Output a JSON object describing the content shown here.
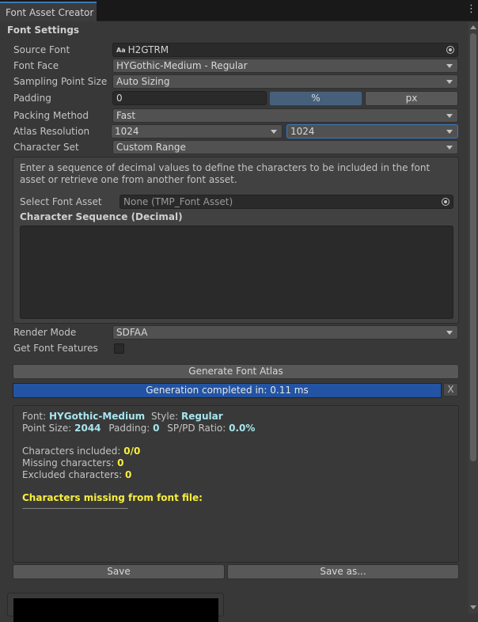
{
  "window": {
    "tab_title": "Font Asset Creator",
    "menu_icon": "kebab-menu-icon"
  },
  "font_settings": {
    "section_title": "Font Settings",
    "source_font": {
      "label": "Source Font",
      "value": "H2GTRM",
      "icon": "font-asset-icon"
    },
    "font_face": {
      "label": "Font Face",
      "value": "HYGothic-Medium - Regular"
    },
    "sampling_point_size": {
      "label": "Sampling Point Size",
      "value": "Auto Sizing"
    },
    "padding": {
      "label": "Padding",
      "value": "0",
      "unit_percent": "%",
      "unit_px": "px",
      "selected_unit": "%"
    },
    "packing_method": {
      "label": "Packing Method",
      "value": "Fast"
    },
    "atlas_resolution": {
      "label": "Atlas Resolution",
      "width": "1024",
      "height": "1024"
    },
    "character_set": {
      "label": "Character Set",
      "value": "Custom Range"
    }
  },
  "custom_range": {
    "help_text": "Enter a sequence of decimal values to define the characters to be included in the font asset or retrieve one from another font asset.",
    "select_font_asset": {
      "label": "Select Font Asset",
      "value": "None (TMP_Font Asset)"
    },
    "character_sequence": {
      "label": "Character Sequence (Decimal)",
      "value": ""
    }
  },
  "render": {
    "render_mode": {
      "label": "Render Mode",
      "value": "SDFAA"
    },
    "get_font_features": {
      "label": "Get Font Features",
      "checked": false
    }
  },
  "actions": {
    "generate_label": "Generate Font Atlas",
    "progress_text": "Generation completed in: 0.11 ms",
    "progress": 1.0,
    "cancel_label": "X",
    "save_label": "Save",
    "save_as_label": "Save as..."
  },
  "results": {
    "font_label": "Font:",
    "font_value": "HYGothic-Medium",
    "style_label": "Style:",
    "style_value": "Regular",
    "point_size_label": "Point Size:",
    "point_size_value": "2044",
    "padding_label": "Padding:",
    "padding_value": "0",
    "ratio_label": "SP/PD Ratio:",
    "ratio_value": "0.0%",
    "included_label": "Characters included:",
    "included_value": "0/0",
    "missing_label": "Missing characters:",
    "missing_value": "0",
    "excluded_label": "Excluded characters:",
    "excluded_value": "0",
    "missing_from_file_label": "Characters missing from font file:",
    "separator": "----------------------------------------"
  },
  "colors": {
    "accent": "#3a79bb",
    "progress_fill": "#2354a3",
    "highlight_cyan": "#a6e6ee",
    "highlight_yellow": "#f7ef3d"
  }
}
